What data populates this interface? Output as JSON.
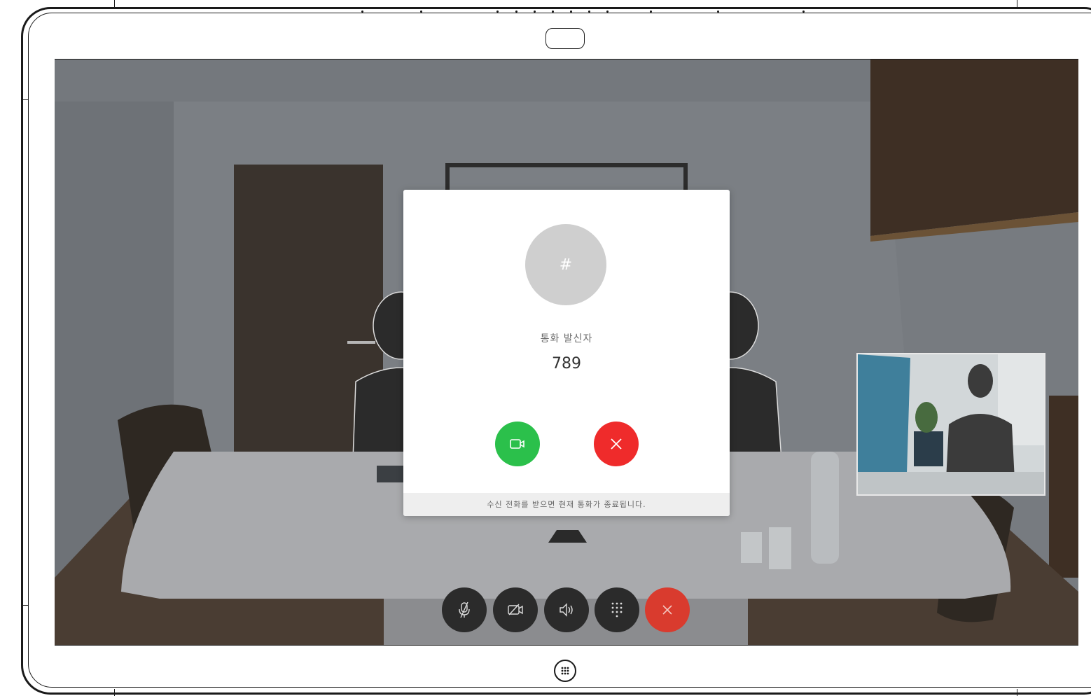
{
  "incoming_call": {
    "avatar_symbol": "#",
    "label": "통화 발신자",
    "number": "789",
    "footer_note": "수신 전화를 받으면 현재 통화가 종료됩니다."
  },
  "colors": {
    "accept": "#2bc04b",
    "decline": "#ef2b2b",
    "end_call": "#d93b2e",
    "control_bg": "#2b2b2b"
  },
  "icons": {
    "accept": "video-camera-icon",
    "decline": "close-icon",
    "mute": "microphone-muted-icon",
    "camera": "camera-off-icon",
    "volume": "speaker-icon",
    "keypad": "keypad-icon",
    "end": "close-icon",
    "home": "home-grid-icon"
  }
}
